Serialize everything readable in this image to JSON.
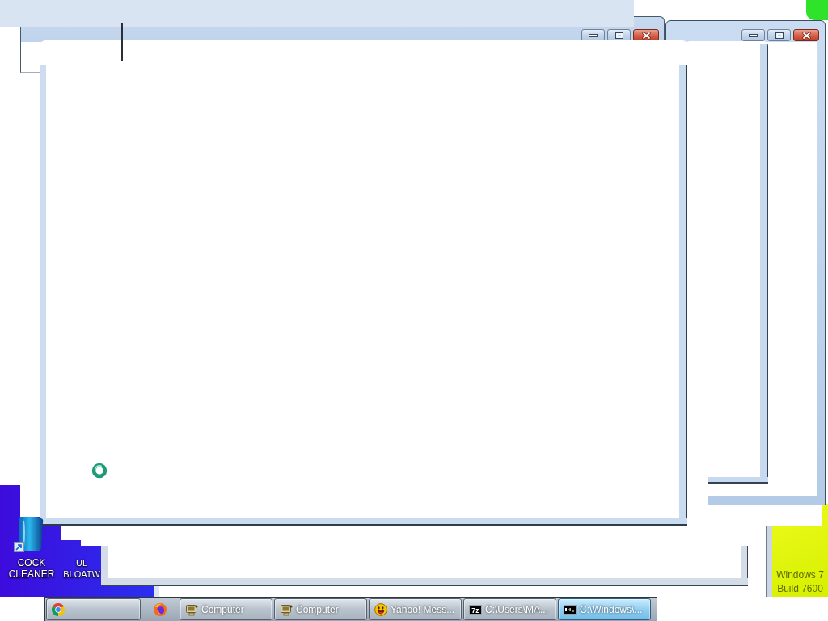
{
  "desktop_icons": [
    {
      "label": "COCK CLEANER"
    },
    {
      "label": "UL BLOATW"
    }
  ],
  "build_info": [
    "Windows 7",
    "Build 7600"
  ],
  "taskbar": {
    "buttons": [
      {
        "kind": "running",
        "selected": false
      },
      {
        "kind": "pinned",
        "selected": false
      },
      {
        "kind": "running",
        "label": "Computer",
        "selected": false
      },
      {
        "kind": "running",
        "label": "Computer",
        "selected": false
      },
      {
        "kind": "running",
        "label": "Yahoo! Mess...",
        "selected": false
      },
      {
        "kind": "running",
        "label": "C:\\Users\\MA...",
        "icon_text": "7z",
        "selected": false
      },
      {
        "kind": "running",
        "label": "C:\\Windows\\...",
        "selected": true
      }
    ]
  }
}
